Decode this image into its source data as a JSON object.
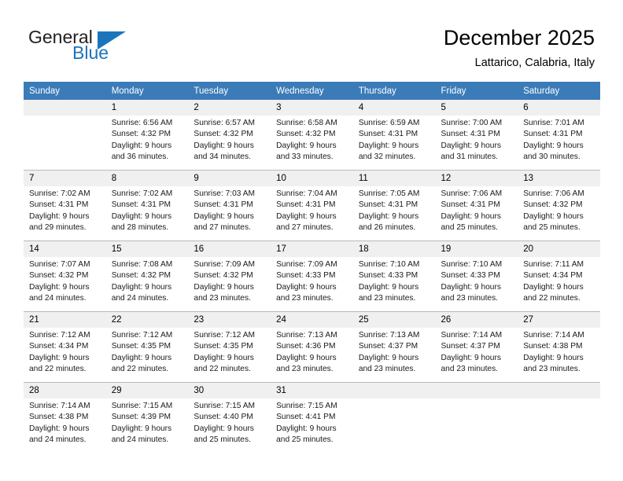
{
  "brand": {
    "name_part1": "General",
    "name_part2": "Blue",
    "accent_color": "#1b75bb"
  },
  "header": {
    "title": "December 2025",
    "location": "Lattarico, Calabria, Italy"
  },
  "theme": {
    "header_row_color": "#3b7cb8",
    "daynum_band_color": "#f0f0f0",
    "grid_line_color": "#b9b9b9"
  },
  "weekdays": [
    "Sunday",
    "Monday",
    "Tuesday",
    "Wednesday",
    "Thursday",
    "Friday",
    "Saturday"
  ],
  "weeks": [
    [
      {
        "day": "",
        "sunrise": "",
        "sunset": "",
        "daylight1": "",
        "daylight2": ""
      },
      {
        "day": "1",
        "sunrise": "Sunrise: 6:56 AM",
        "sunset": "Sunset: 4:32 PM",
        "daylight1": "Daylight: 9 hours",
        "daylight2": "and 36 minutes."
      },
      {
        "day": "2",
        "sunrise": "Sunrise: 6:57 AM",
        "sunset": "Sunset: 4:32 PM",
        "daylight1": "Daylight: 9 hours",
        "daylight2": "and 34 minutes."
      },
      {
        "day": "3",
        "sunrise": "Sunrise: 6:58 AM",
        "sunset": "Sunset: 4:32 PM",
        "daylight1": "Daylight: 9 hours",
        "daylight2": "and 33 minutes."
      },
      {
        "day": "4",
        "sunrise": "Sunrise: 6:59 AM",
        "sunset": "Sunset: 4:31 PM",
        "daylight1": "Daylight: 9 hours",
        "daylight2": "and 32 minutes."
      },
      {
        "day": "5",
        "sunrise": "Sunrise: 7:00 AM",
        "sunset": "Sunset: 4:31 PM",
        "daylight1": "Daylight: 9 hours",
        "daylight2": "and 31 minutes."
      },
      {
        "day": "6",
        "sunrise": "Sunrise: 7:01 AM",
        "sunset": "Sunset: 4:31 PM",
        "daylight1": "Daylight: 9 hours",
        "daylight2": "and 30 minutes."
      }
    ],
    [
      {
        "day": "7",
        "sunrise": "Sunrise: 7:02 AM",
        "sunset": "Sunset: 4:31 PM",
        "daylight1": "Daylight: 9 hours",
        "daylight2": "and 29 minutes."
      },
      {
        "day": "8",
        "sunrise": "Sunrise: 7:02 AM",
        "sunset": "Sunset: 4:31 PM",
        "daylight1": "Daylight: 9 hours",
        "daylight2": "and 28 minutes."
      },
      {
        "day": "9",
        "sunrise": "Sunrise: 7:03 AM",
        "sunset": "Sunset: 4:31 PM",
        "daylight1": "Daylight: 9 hours",
        "daylight2": "and 27 minutes."
      },
      {
        "day": "10",
        "sunrise": "Sunrise: 7:04 AM",
        "sunset": "Sunset: 4:31 PM",
        "daylight1": "Daylight: 9 hours",
        "daylight2": "and 27 minutes."
      },
      {
        "day": "11",
        "sunrise": "Sunrise: 7:05 AM",
        "sunset": "Sunset: 4:31 PM",
        "daylight1": "Daylight: 9 hours",
        "daylight2": "and 26 minutes."
      },
      {
        "day": "12",
        "sunrise": "Sunrise: 7:06 AM",
        "sunset": "Sunset: 4:31 PM",
        "daylight1": "Daylight: 9 hours",
        "daylight2": "and 25 minutes."
      },
      {
        "day": "13",
        "sunrise": "Sunrise: 7:06 AM",
        "sunset": "Sunset: 4:32 PM",
        "daylight1": "Daylight: 9 hours",
        "daylight2": "and 25 minutes."
      }
    ],
    [
      {
        "day": "14",
        "sunrise": "Sunrise: 7:07 AM",
        "sunset": "Sunset: 4:32 PM",
        "daylight1": "Daylight: 9 hours",
        "daylight2": "and 24 minutes."
      },
      {
        "day": "15",
        "sunrise": "Sunrise: 7:08 AM",
        "sunset": "Sunset: 4:32 PM",
        "daylight1": "Daylight: 9 hours",
        "daylight2": "and 24 minutes."
      },
      {
        "day": "16",
        "sunrise": "Sunrise: 7:09 AM",
        "sunset": "Sunset: 4:32 PM",
        "daylight1": "Daylight: 9 hours",
        "daylight2": "and 23 minutes."
      },
      {
        "day": "17",
        "sunrise": "Sunrise: 7:09 AM",
        "sunset": "Sunset: 4:33 PM",
        "daylight1": "Daylight: 9 hours",
        "daylight2": "and 23 minutes."
      },
      {
        "day": "18",
        "sunrise": "Sunrise: 7:10 AM",
        "sunset": "Sunset: 4:33 PM",
        "daylight1": "Daylight: 9 hours",
        "daylight2": "and 23 minutes."
      },
      {
        "day": "19",
        "sunrise": "Sunrise: 7:10 AM",
        "sunset": "Sunset: 4:33 PM",
        "daylight1": "Daylight: 9 hours",
        "daylight2": "and 23 minutes."
      },
      {
        "day": "20",
        "sunrise": "Sunrise: 7:11 AM",
        "sunset": "Sunset: 4:34 PM",
        "daylight1": "Daylight: 9 hours",
        "daylight2": "and 22 minutes."
      }
    ],
    [
      {
        "day": "21",
        "sunrise": "Sunrise: 7:12 AM",
        "sunset": "Sunset: 4:34 PM",
        "daylight1": "Daylight: 9 hours",
        "daylight2": "and 22 minutes."
      },
      {
        "day": "22",
        "sunrise": "Sunrise: 7:12 AM",
        "sunset": "Sunset: 4:35 PM",
        "daylight1": "Daylight: 9 hours",
        "daylight2": "and 22 minutes."
      },
      {
        "day": "23",
        "sunrise": "Sunrise: 7:12 AM",
        "sunset": "Sunset: 4:35 PM",
        "daylight1": "Daylight: 9 hours",
        "daylight2": "and 22 minutes."
      },
      {
        "day": "24",
        "sunrise": "Sunrise: 7:13 AM",
        "sunset": "Sunset: 4:36 PM",
        "daylight1": "Daylight: 9 hours",
        "daylight2": "and 23 minutes."
      },
      {
        "day": "25",
        "sunrise": "Sunrise: 7:13 AM",
        "sunset": "Sunset: 4:37 PM",
        "daylight1": "Daylight: 9 hours",
        "daylight2": "and 23 minutes."
      },
      {
        "day": "26",
        "sunrise": "Sunrise: 7:14 AM",
        "sunset": "Sunset: 4:37 PM",
        "daylight1": "Daylight: 9 hours",
        "daylight2": "and 23 minutes."
      },
      {
        "day": "27",
        "sunrise": "Sunrise: 7:14 AM",
        "sunset": "Sunset: 4:38 PM",
        "daylight1": "Daylight: 9 hours",
        "daylight2": "and 23 minutes."
      }
    ],
    [
      {
        "day": "28",
        "sunrise": "Sunrise: 7:14 AM",
        "sunset": "Sunset: 4:38 PM",
        "daylight1": "Daylight: 9 hours",
        "daylight2": "and 24 minutes."
      },
      {
        "day": "29",
        "sunrise": "Sunrise: 7:15 AM",
        "sunset": "Sunset: 4:39 PM",
        "daylight1": "Daylight: 9 hours",
        "daylight2": "and 24 minutes."
      },
      {
        "day": "30",
        "sunrise": "Sunrise: 7:15 AM",
        "sunset": "Sunset: 4:40 PM",
        "daylight1": "Daylight: 9 hours",
        "daylight2": "and 25 minutes."
      },
      {
        "day": "31",
        "sunrise": "Sunrise: 7:15 AM",
        "sunset": "Sunset: 4:41 PM",
        "daylight1": "Daylight: 9 hours",
        "daylight2": "and 25 minutes."
      },
      {
        "day": "",
        "sunrise": "",
        "sunset": "",
        "daylight1": "",
        "daylight2": ""
      },
      {
        "day": "",
        "sunrise": "",
        "sunset": "",
        "daylight1": "",
        "daylight2": ""
      },
      {
        "day": "",
        "sunrise": "",
        "sunset": "",
        "daylight1": "",
        "daylight2": ""
      }
    ]
  ]
}
